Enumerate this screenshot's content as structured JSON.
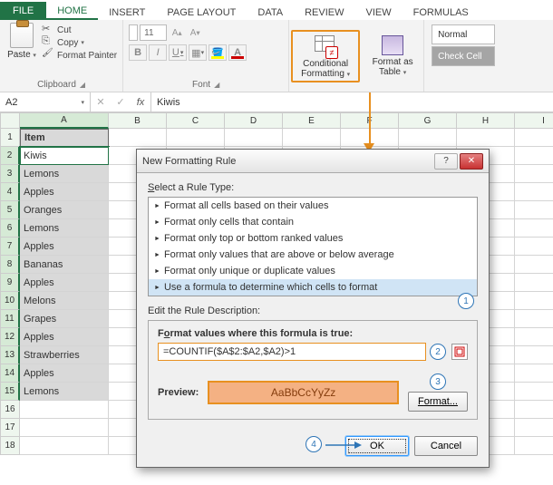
{
  "tabs": {
    "file": "FILE",
    "home": "HOME",
    "insert": "INSERT",
    "pagelayout": "PAGE LAYOUT",
    "data": "DATA",
    "review": "REVIEW",
    "view": "VIEW",
    "formulas": "FORMULAS"
  },
  "ribbon": {
    "clipboard": {
      "paste": "Paste",
      "cut": "Cut",
      "copy": "Copy",
      "painter": "Format Painter",
      "group": "Clipboard"
    },
    "font": {
      "size": "11",
      "group": "Font",
      "bold": "B",
      "italic": "I",
      "underline": "U"
    },
    "cond": {
      "label": "Conditional Formatting"
    },
    "fat": {
      "label": "Format as Table"
    },
    "styles": {
      "normal": "Normal",
      "check": "Check Cell"
    }
  },
  "namebox": "A2",
  "fx_value": "Kiwis",
  "grid": {
    "cols": [
      "A",
      "B",
      "C",
      "D",
      "E",
      "F",
      "G",
      "H",
      "I"
    ],
    "header": "Item",
    "items": [
      "Kiwis",
      "Lemons",
      "Apples",
      "Oranges",
      "Lemons",
      "Apples",
      "Bananas",
      "Apples",
      "Melons",
      "Grapes",
      "Apples",
      "Strawberries",
      "Apples",
      "Lemons"
    ]
  },
  "dialog": {
    "title": "New Formatting Rule",
    "select_label": "Select a Rule Type:",
    "rules": [
      "Format all cells based on their values",
      "Format only cells that contain",
      "Format only top or bottom ranked values",
      "Format only values that are above or below average",
      "Format only unique or duplicate values",
      "Use a formula to determine which cells to format"
    ],
    "edit_label": "Edit the Rule Description:",
    "formula_label": "Format values where this formula is true:",
    "formula": "=COUNTIF($A$2:$A2,$A2)>1",
    "preview_label": "Preview:",
    "preview_text": "AaBbCcYyZz",
    "format_btn": "Format...",
    "ok": "OK",
    "cancel": "Cancel"
  },
  "badges": {
    "b1": "1",
    "b2": "2",
    "b3": "3",
    "b4": "4"
  }
}
